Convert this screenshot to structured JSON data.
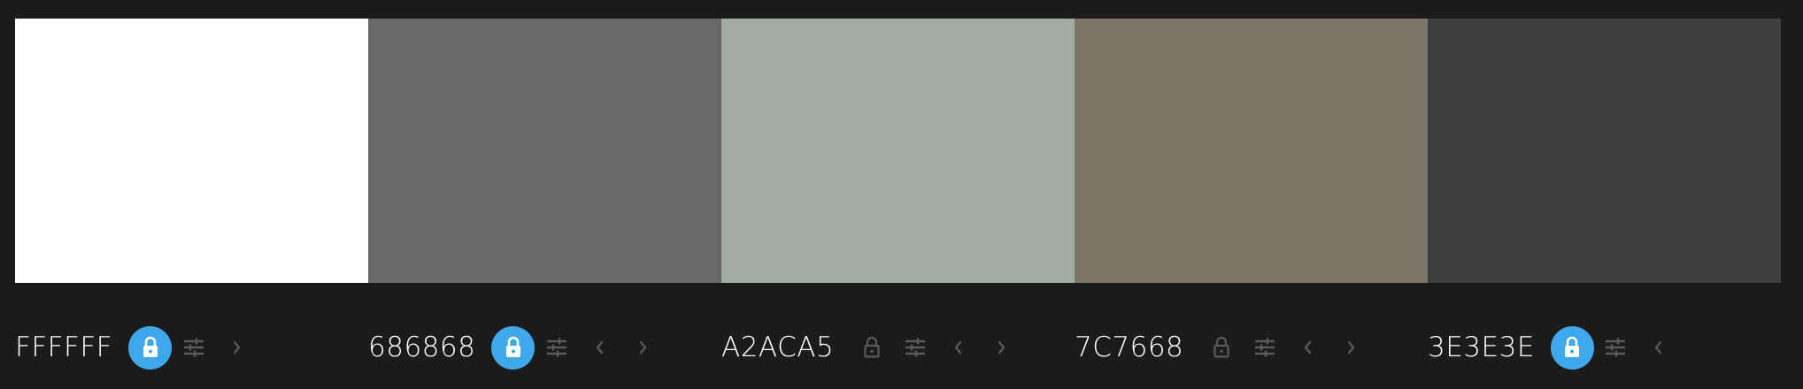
{
  "palette": {
    "colors": [
      {
        "hex": "FFFFFF",
        "color": "#ffffff",
        "locked": true,
        "lock_icon": "lock-icon",
        "adjust_icon": "sliders-icon",
        "has_prev": false,
        "has_next": true
      },
      {
        "hex": "686868",
        "color": "#686868",
        "locked": true,
        "lock_icon": "lock-icon",
        "adjust_icon": "sliders-icon",
        "has_prev": true,
        "has_next": true
      },
      {
        "hex": "A2ACA5",
        "color": "#a2aca5",
        "locked": false,
        "lock_icon": "lock-icon",
        "adjust_icon": "sliders-icon",
        "has_prev": true,
        "has_next": true
      },
      {
        "hex": "7C7668",
        "color": "#7c7668",
        "locked": false,
        "lock_icon": "lock-icon",
        "adjust_icon": "sliders-icon",
        "has_prev": true,
        "has_next": true
      },
      {
        "hex": "3E3E3E",
        "color": "#3e3e3e",
        "locked": true,
        "lock_icon": "lock-icon",
        "adjust_icon": "sliders-icon",
        "has_prev": true,
        "has_next": false
      }
    ],
    "accent_color": "#3fa8ea",
    "icon_color": "#5a5a5a",
    "background": "#1b1b1b"
  }
}
